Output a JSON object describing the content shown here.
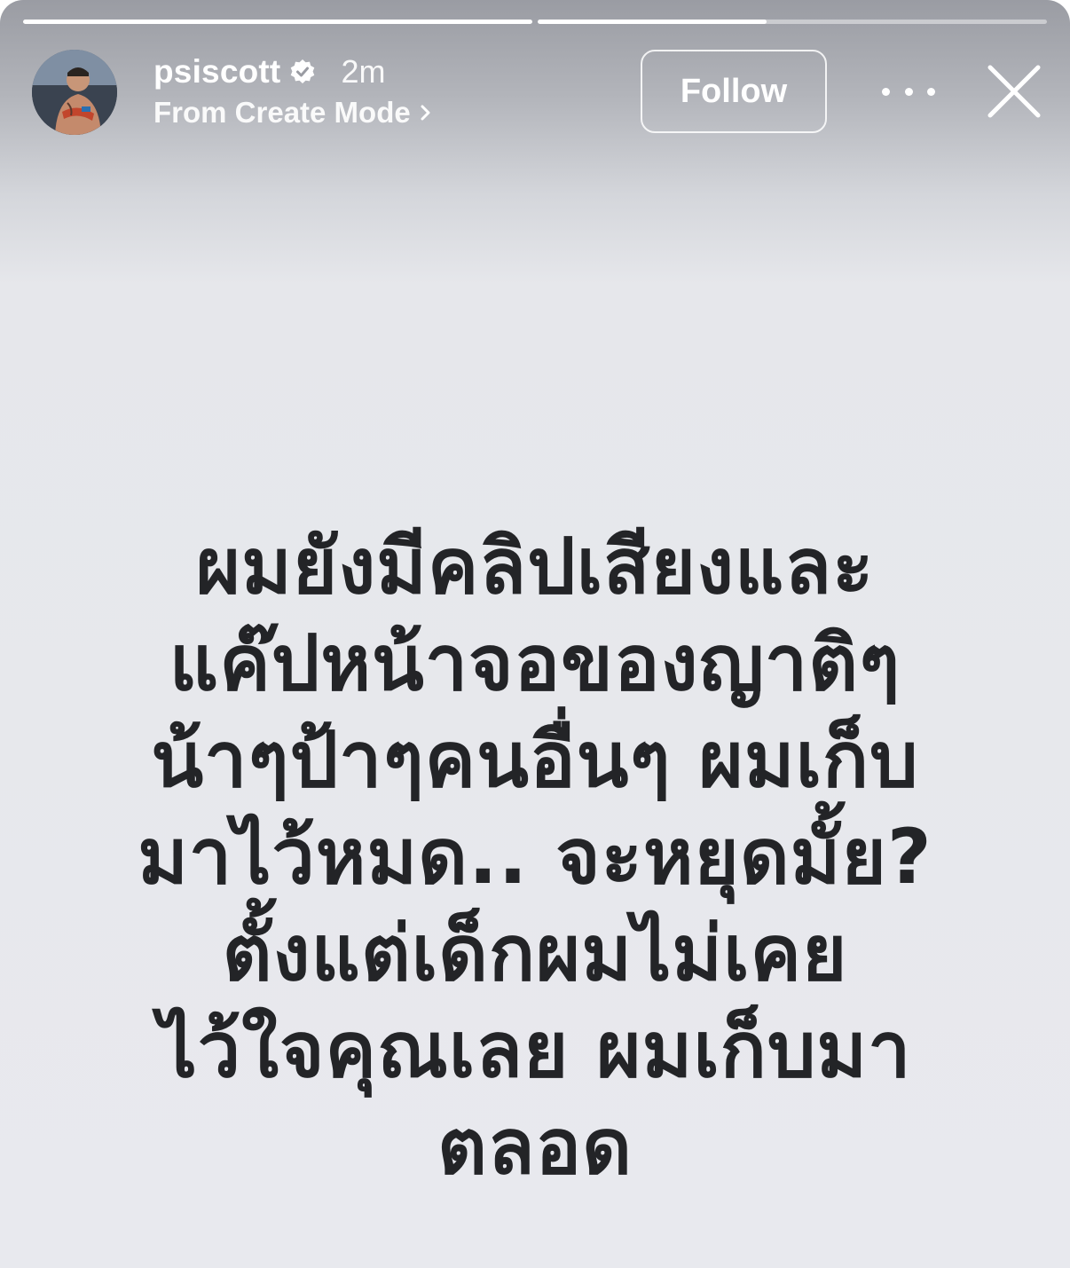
{
  "story": {
    "progress": [
      1.0,
      0.45
    ]
  },
  "header": {
    "username": "psiscott",
    "verified": true,
    "time": "2m",
    "subtitle": "From Create Mode",
    "follow_label": "Follow",
    "icons": {
      "verified": "verified-badge-icon",
      "subtitle_chevron": "chevron-right-icon",
      "more": "more-options-icon",
      "close": "close-icon"
    }
  },
  "content": {
    "lines": [
      "ผมยังมีคลิปเสียงและ",
      "แค๊ปหน้าจอของญาติๆ",
      "น้าๆป้าๆคนอื่นๆ ผมเก็บ",
      "มาไว้หมด.. จะหยุดมั้ย?",
      "ตั้งแต่เด็กผมไม่เคย",
      "ไว้ใจคุณเลย ผมเก็บมา",
      "ตลอด"
    ]
  },
  "colors": {
    "text": "#232427",
    "background": "#e8e9ee",
    "header_text": "#ffffff"
  }
}
